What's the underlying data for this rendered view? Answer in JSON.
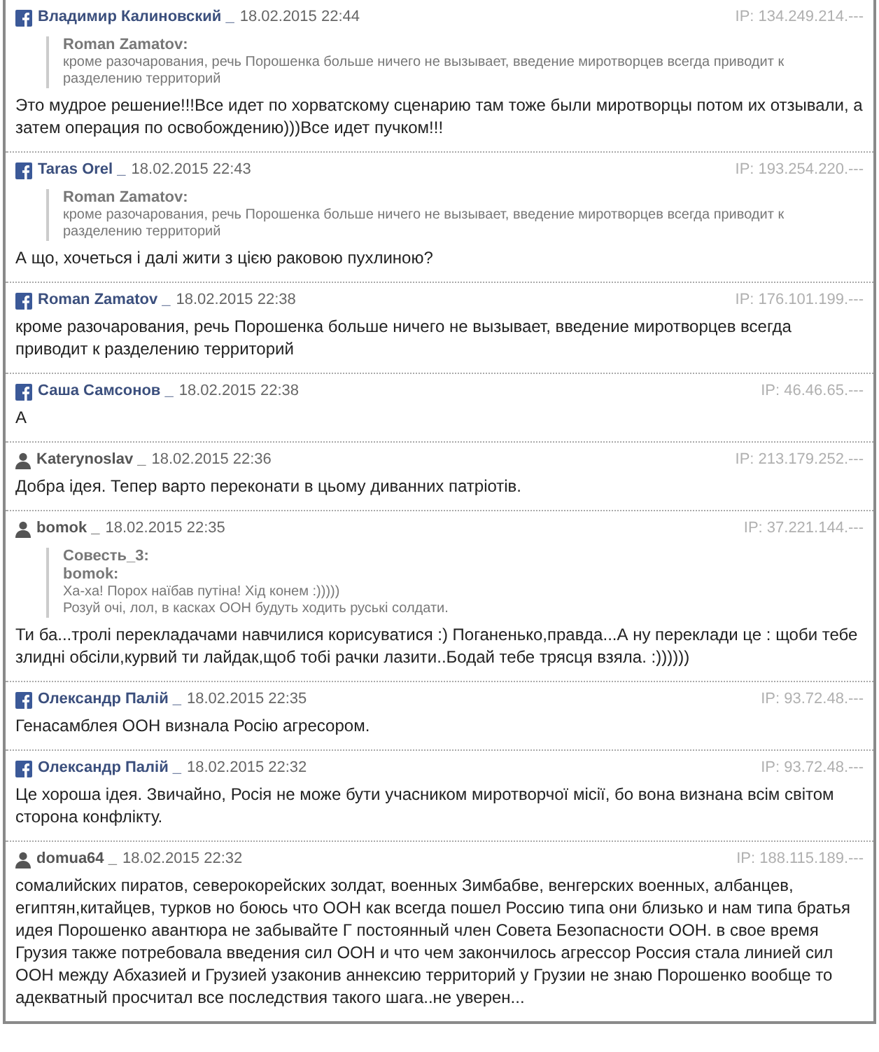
{
  "comments": [
    {
      "kind": "facebook",
      "author": "Владимир Калиновский _",
      "date": "18.02.2015 22:44",
      "ip": "IP: 134.249.214.---",
      "quote": {
        "authors": [
          "Roman Zamatov:"
        ],
        "lines": [
          "кроме разочарования, речь Порошенка больше ничего не вызывает, введение миротворцев всегда приводит к разделению территорий"
        ]
      },
      "text": "Это мудрое решение!!!Все идет по хорватскому сценарию там тоже были миротворцы потом их отзывали, а затем операция по освобождению)))Все идет пучком!!!"
    },
    {
      "kind": "facebook",
      "author": "Taras Orel _",
      "date": "18.02.2015 22:43",
      "ip": "IP: 193.254.220.---",
      "quote": {
        "authors": [
          "Roman Zamatov:"
        ],
        "lines": [
          "кроме разочарования, речь Порошенка больше ничего не вызывает, введение миротворцев всегда приводит к разделению территорий"
        ]
      },
      "text": "А що, хочеться і далі жити з цією раковою пухлиною?"
    },
    {
      "kind": "facebook",
      "author": "Roman Zamatov _",
      "date": "18.02.2015 22:38",
      "ip": "IP: 176.101.199.---",
      "text": "кроме разочарования, речь Порошенка больше ничего не вызывает, введение миротворцев всегда приводит к разделению территорий"
    },
    {
      "kind": "facebook",
      "author": "Саша Самсонов _",
      "date": "18.02.2015 22:38",
      "ip": "IP: 46.46.65.---",
      "text": "А"
    },
    {
      "kind": "site",
      "author": "Katerynoslav _",
      "date": "18.02.2015 22:36",
      "ip": "IP: 213.179.252.---",
      "text": "Добра ідея. Тепер варто переконати в цьому диванних патріотів."
    },
    {
      "kind": "site",
      "author": "bomok _",
      "date": "18.02.2015 22:35",
      "ip": "IP: 37.221.144.---",
      "quote": {
        "authors": [
          "Совесть_3:",
          "bomok:"
        ],
        "lines": [
          "Ха-ха! Порох наїбав путіна! Хід конем :)))))",
          "Розуй очі, лол, в касках ООН будуть ходить руські солдати."
        ]
      },
      "text": "Ти ба...тролі перекладачами навчилися корисуватися :) Поганенько,правда...А ну переклади це : щоби тебе злидні обсіли,курвий ти лайдак,щоб тобі рачки лазити..Бодай тебе трясця взяла. :))))))"
    },
    {
      "kind": "facebook",
      "author": "Олександр Палій _",
      "date": "18.02.2015 22:35",
      "ip": "IP: 93.72.48.---",
      "text": "Генасамблея ООН визнала Росію агресором."
    },
    {
      "kind": "facebook",
      "author": "Олександр Палій _",
      "date": "18.02.2015 22:32",
      "ip": "IP: 93.72.48.---",
      "text": "Це хороша ідея. Звичайно, Росія не може бути учасником миротворчої місії, бо вона визнана всім світом сторона конфлікту."
    },
    {
      "kind": "site",
      "author": "domua64 _",
      "date": "18.02.2015 22:32",
      "ip": "IP: 188.115.189.---",
      "text": "сомалийских пиратов, северокорейских золдат, военных Зимбабве, венгерских военных, албанцев, египтян,китайцев, турков но боюсь что ООН как всегда пошел Россию типа они близько и нам типа братья идея Порошенко авантюра не забывайте Г постоянный член Совета Безопасности ООН. в свое время Грузия также потребовала введения сил ООН и что чем закончилось агрессор Россия стала линией сил ООН между Абхазией и Грузией узаконив аннексию территорий у Грузии не знаю Порошенко вообще то адекватный просчитал все последствия такого шага..не уверен..."
    }
  ]
}
